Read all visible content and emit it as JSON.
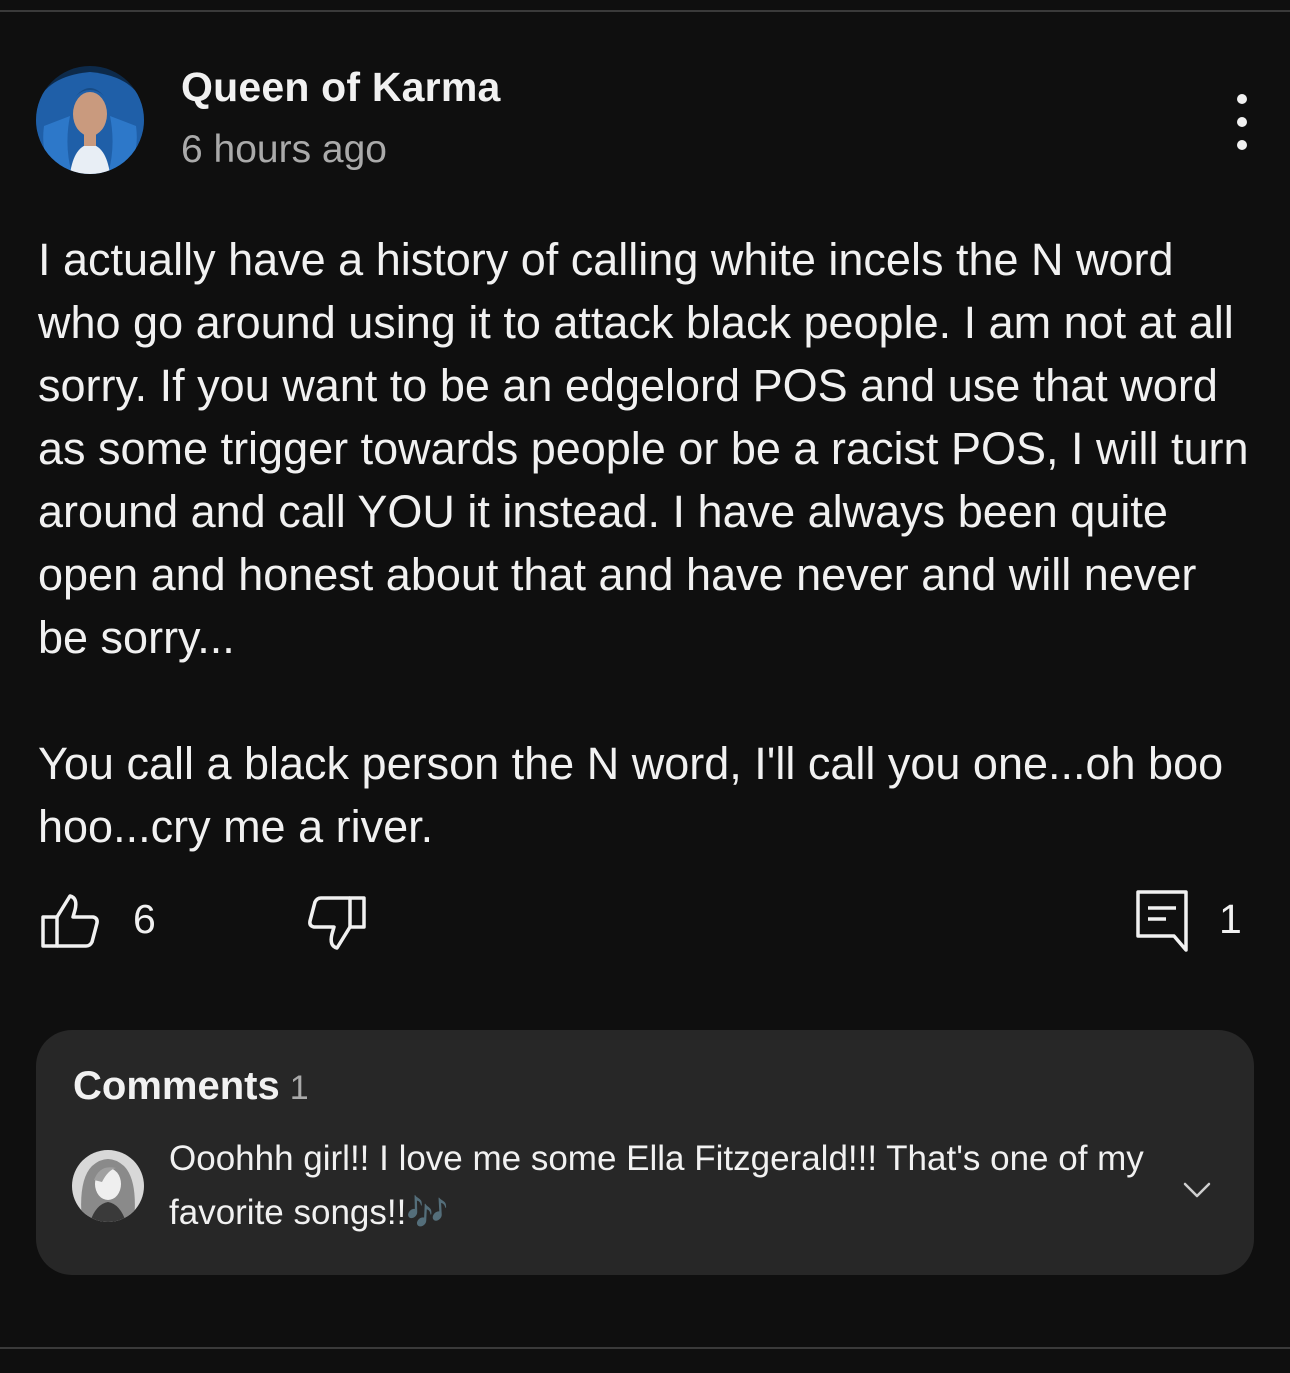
{
  "post": {
    "author_name": "Queen of Karma",
    "timestamp": "6 hours ago",
    "paragraphs": [
      "I actually have a history of calling white incels the N word who go around using it to attack black people. I am not at all sorry. If you want to be an edgelord POS and use that word as some trigger towards people or be a racist POS, I will turn around and call YOU it instead. I have always been quite open and honest about that and have never and will never be sorry...",
      "You call a black person the N word, I'll call you one...oh boo hoo...cry me a river."
    ],
    "like_count": "6",
    "comment_count": "1"
  },
  "comments": {
    "title": "Comments",
    "count": "1",
    "top_comment": {
      "text": "Ooohhh girl!! I love me some Ella Fitzgerald!!! That's one of my favorite songs!!",
      "emoji": "🎶"
    }
  },
  "icons": {
    "more": "vertical-ellipsis-icon",
    "like": "thumbs-up-icon",
    "dislike": "thumbs-down-icon",
    "comment": "comment-bubble-icon",
    "expand": "chevron-down-icon"
  },
  "colors": {
    "background": "#0f0f0f",
    "text": "#f1f1f1",
    "secondary_text": "#aaaaaa",
    "panel": "#272727",
    "avatar_hair": "#1f5fa8"
  }
}
